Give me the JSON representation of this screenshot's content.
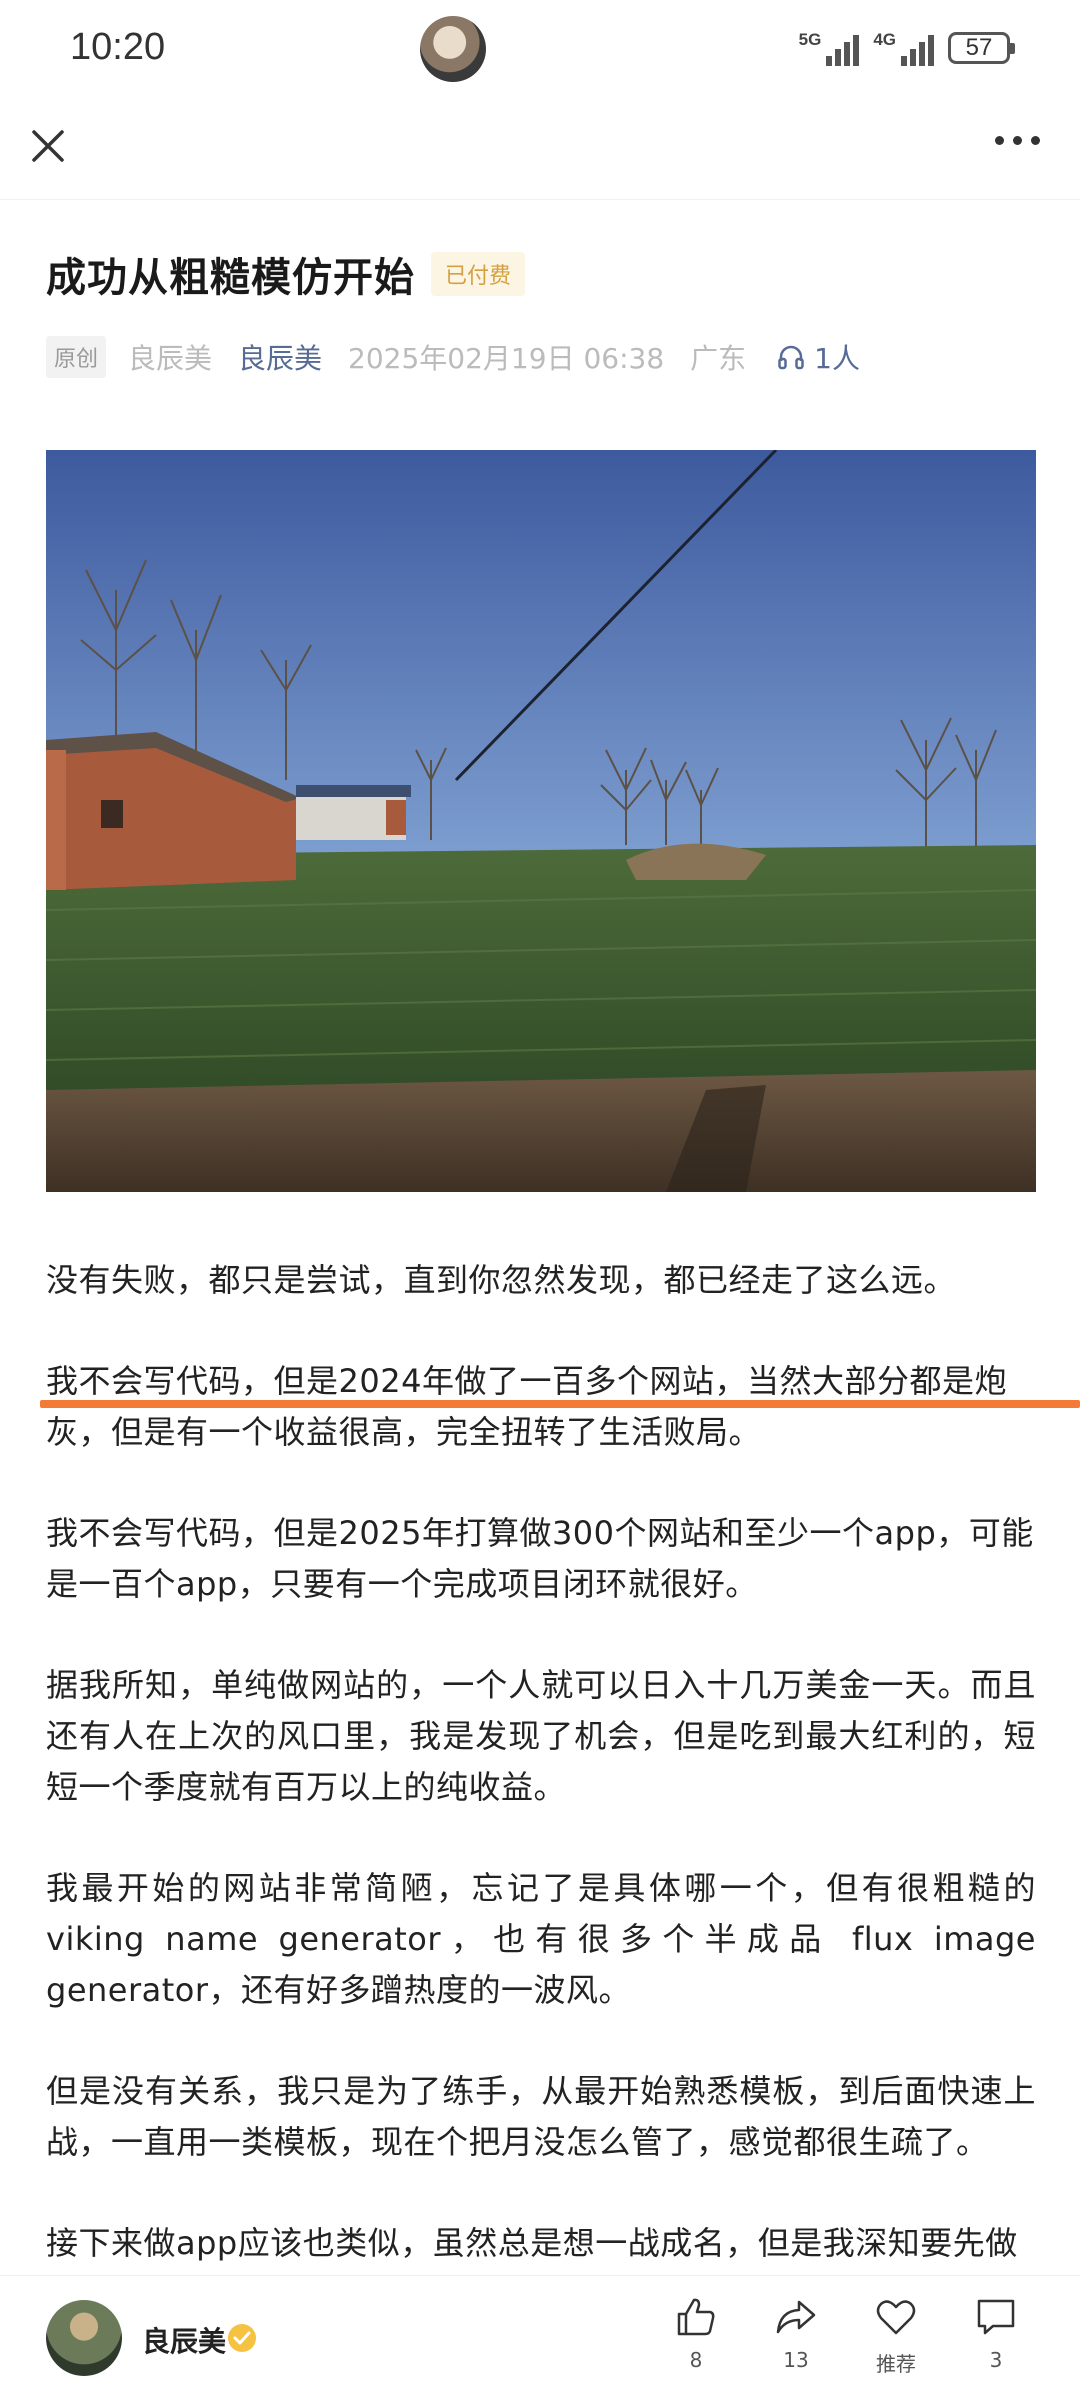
{
  "status_bar": {
    "time": "10:20",
    "net1_label": "5G",
    "net2_label": "4G",
    "battery": "57"
  },
  "article": {
    "title": "成功从粗糙模仿开始",
    "paid_badge": "已付费",
    "original_badge": "原创",
    "author_plain": "良辰美",
    "author_link": "良辰美",
    "date": "2025年02月19日 06:38",
    "location": "广东",
    "listeners": "1人",
    "paragraphs": [
      "没有失败，都只是尝试，直到你忽然发现，都已经走了这么远。",
      "我不会写代码，但是2024年做了一百多个网站，当然大部分都是炮灰，但是有一个收益很高，完全扭转了生活败局。",
      "我不会写代码，但是2025年打算做300个网站和至少一个app，可能是一百个app，只要有一个完成项目闭环就很好。",
      "据我所知，单纯做网站的，一个人就可以日入十几万美金一天。而且还有人在上次的风口里，我是发现了机会，但是吃到最大红利的，短短一个季度就有百万以上的纯收益。",
      "我最开始的网站非常简陋，忘记了是具体哪一个，但有很粗糙的viking name generator，也有很多个半成品 flux image generator，还有好多蹭热度的一波风。",
      "但是没有关系，我只是为了练手，从最开始熟悉模板，到后面快速上战，一直用一类模板，现在个把月没怎么管了，感觉都很生疏了。",
      "接下来做app应该也类似，虽然总是想一战成名，但是我深知要先做"
    ]
  },
  "bottom_bar": {
    "author_name": "良辰美",
    "like_count": "8",
    "share_count": "13",
    "recommend_label": "推荐",
    "comment_count": "3"
  },
  "colors": {
    "link": "#576b95",
    "highlight": "#f47b35",
    "paid_badge_bg": "#fdf5e3",
    "paid_badge_text": "#d4a142"
  }
}
